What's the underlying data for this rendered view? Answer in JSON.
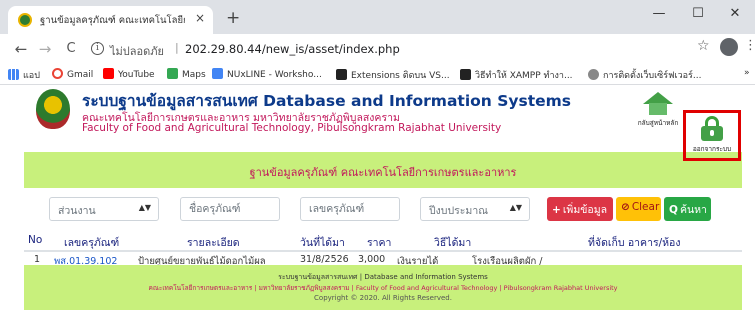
{
  "browser": {
    "tab_title": "ฐานข้อมูลครุภัณฑ์ คณะเทคโนโลยีการ",
    "tab_close": "×",
    "new_tab": "+",
    "window_controls": {
      "minimize": "—",
      "maximize": "☐",
      "close": "✕"
    },
    "nav": {
      "back": "←",
      "forward": "→",
      "reload": "C"
    },
    "security_text": "ไม่ปลอดภัย",
    "url": "202.29.80.44/new_is/asset/index.php",
    "bookmarks": [
      {
        "label": "แอป",
        "icon": "apps-grid-icon",
        "color": "#4285f4"
      },
      {
        "label": "Gmail",
        "icon": "google-icon",
        "color": "#ea4335"
      },
      {
        "label": "YouTube",
        "icon": "youtube-icon",
        "color": "#ff0000"
      },
      {
        "label": "Maps",
        "icon": "maps-icon",
        "color": "#34a853"
      },
      {
        "label": "NUxLINE - Worksho...",
        "icon": "forms-icon",
        "color": "#4285f4"
      },
      {
        "label": "Extensions ติดบน VS...",
        "icon": "m-icon",
        "color": "#222222"
      },
      {
        "label": "วิธีทำให้ XAMPP ทำงา...",
        "icon": "m-icon",
        "color": "#222222"
      },
      {
        "label": "การติดตั้งเว็บเซิร์ฟเวอร์...",
        "icon": "link-icon",
        "color": "#888888"
      }
    ],
    "bookmarks_more": "»"
  },
  "header": {
    "title": "ระบบฐานข้อมูลสารสนเทศ Database and Information Systems",
    "faculty_th": "คณะเทคโนโลยีการเกษตรและอาหาร มหาวิทยาลัยราชภัฏพิบูลสงคราม",
    "faculty_en": "Faculty of Food and Agricultural Technology, Pibulsongkram Rajabhat University",
    "home_label": "กลับสู่หน้าหลัก",
    "logout_label": "ออกจากระบบ"
  },
  "banner": "ฐานข้อมูลครุภัณฑ์ คณะเทคโนโลยีการเกษตรและอาหาร",
  "filters": {
    "department": "ส่วนงาน",
    "asset_name_placeholder": "ชื่อครุภัณฑ์",
    "asset_no_placeholder": "เลขครุภัณฑ์",
    "budget_year": "ปีงบประมาณ",
    "add_button": "เพิ่มข้อมูล",
    "clear_button": "Clear",
    "search_button": "ค้นหา"
  },
  "table": {
    "headers": [
      "No",
      "เลขครุภัณฑ์",
      "รายละเอียด",
      "วันที่ได้มา",
      "ราคา",
      "วิธีได้มา",
      "ที่จัดเก็บ อาคาร/ห้อง"
    ],
    "rows": [
      [
        "1",
        "พส.01.39.102",
        "ป้ายศูนย์ขยายพันธ์ไม้ดอกไม้ผล",
        "31/8/2526",
        "3,000",
        "เงินรายได้",
        "โรงเรือนผลิตผัก /"
      ]
    ]
  },
  "footer": {
    "line1": "ระบบฐานข้อมูลสารสนเทศ | Database and Information Systems",
    "line2": "คณะเทคโนโลยีการเกษตรและอาหาร | มหาวิทยาลัยราชภัฏพิบูลสงคราม | Faculty of Food and Agricultural Technology | Pibulsongkram Rajabhat University",
    "line3": "Copyright © 2020. All Rights Reserved."
  },
  "colors": {
    "accent_green": "#c8f07c",
    "title_blue": "#0d3a8a",
    "faculty_pink": "#c2185b",
    "highlight_red": "#e00000"
  }
}
